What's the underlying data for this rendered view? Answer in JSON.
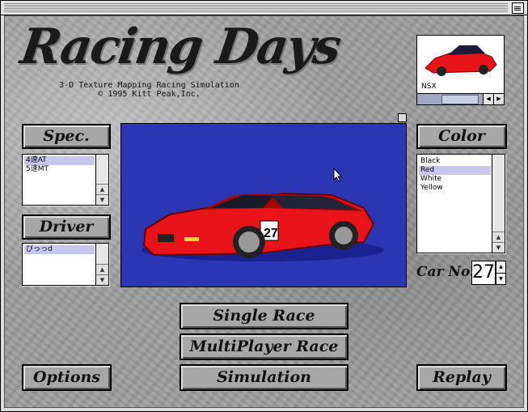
{
  "logo": "Racing Days",
  "subtitle_line1": "3-D Texture Mapping Racing Simulation",
  "subtitle_line2": "© 1995 Kitt Peak,Inc.",
  "thumbnail": {
    "car_name": "NSX"
  },
  "buttons": {
    "spec": "Spec.",
    "driver": "Driver",
    "color": "Color",
    "single_race": "Single Race",
    "multiplayer_race": "MultiPlayer Race",
    "simulation": "Simulation",
    "options": "Options",
    "replay": "Replay"
  },
  "spec_list": [
    "4速AT",
    "5速MT"
  ],
  "driver_list": [
    "ぴっっd"
  ],
  "color_list": [
    "Black",
    "Red",
    "White",
    "Yellow"
  ],
  "car_number_label": "Car No.",
  "car_number": "27",
  "car_decal_number": "27",
  "colors": {
    "preview_bg": "#2a36b2",
    "car": "#e8141a",
    "selection": "#c6c6ee"
  }
}
